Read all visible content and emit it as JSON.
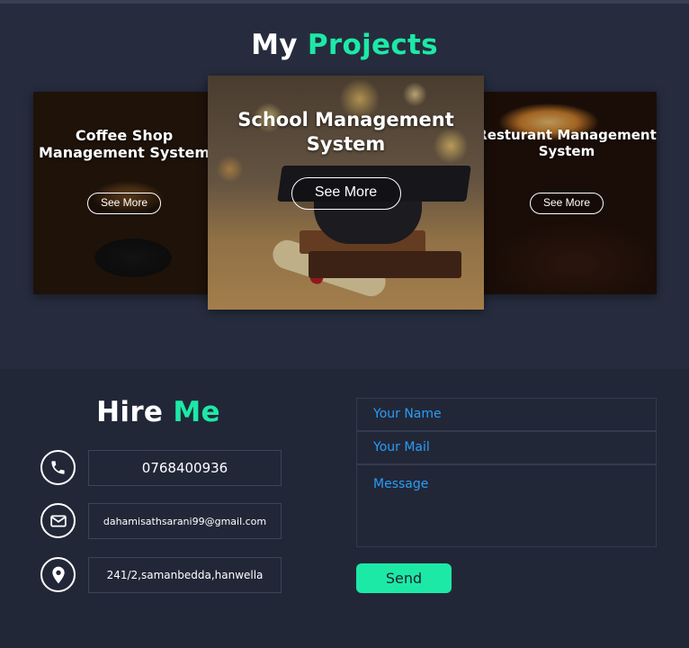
{
  "projects": {
    "title_part1": "My",
    "title_part2": "Projects",
    "cards": [
      {
        "title": "Coffee Shop Management System",
        "button": "See More"
      },
      {
        "title": "School Management System",
        "button": "See More"
      },
      {
        "title": "Resturant Management System",
        "button": "See More"
      }
    ]
  },
  "hire": {
    "title_part1": "Hire",
    "title_part2": "Me",
    "phone": "0768400936",
    "email": "dahamisathsarani99@gmail.com",
    "address": "241/2,samanbedda,hanwella",
    "icons": [
      "phone-icon",
      "mail-icon",
      "location-icon"
    ],
    "form": {
      "name_placeholder": "Your Name",
      "mail_placeholder": "Your Mail",
      "message_placeholder": "Message",
      "send_label": "Send"
    }
  },
  "colors": {
    "accent": "#1de9a6",
    "background": "#262c3e",
    "section_dark": "#222738",
    "placeholder_blue": "#2a9df4"
  }
}
